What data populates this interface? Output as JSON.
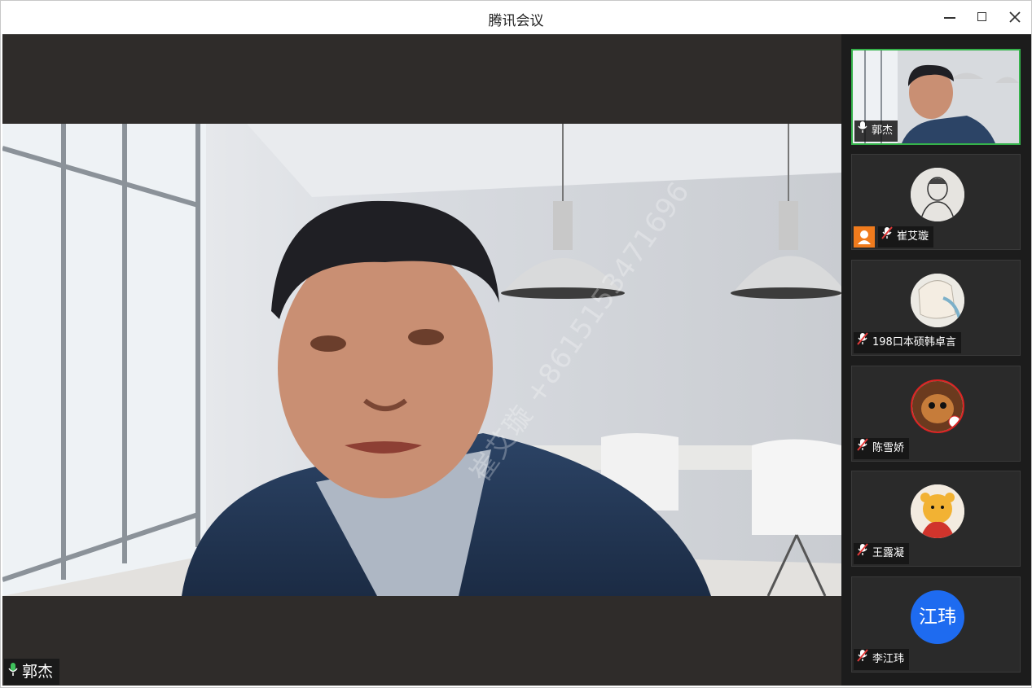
{
  "window": {
    "title": "腾讯会议",
    "minimize_icon": "minimize-icon",
    "maximize_icon": "maximize-icon",
    "close_icon": "close-icon"
  },
  "main_video": {
    "speaker_name": "郭杰",
    "watermark": "崔艾璇 +8615153471696",
    "mic_state": "on",
    "mic_color": "#3ec25b"
  },
  "participants": [
    {
      "name": "郭杰",
      "type": "video",
      "mic": "on",
      "active_speaker": true
    },
    {
      "name": "崔艾璇",
      "type": "avatar-image",
      "mic": "muted",
      "host": true
    },
    {
      "name": "198口本硕韩卓言",
      "type": "avatar-image",
      "mic": "muted"
    },
    {
      "name": "陈雪娇",
      "type": "avatar-image",
      "mic": "muted"
    },
    {
      "name": "王露凝",
      "type": "avatar-image",
      "mic": "muted"
    },
    {
      "name": "李江玮",
      "type": "avatar-text",
      "avatar_text": "江玮",
      "mic": "muted"
    }
  ],
  "colors": {
    "active_border": "#35b24b",
    "host_badge": "#f07b1d",
    "text_avatar_bg": "#1e6bf0",
    "muted_red": "#e23a3a"
  }
}
